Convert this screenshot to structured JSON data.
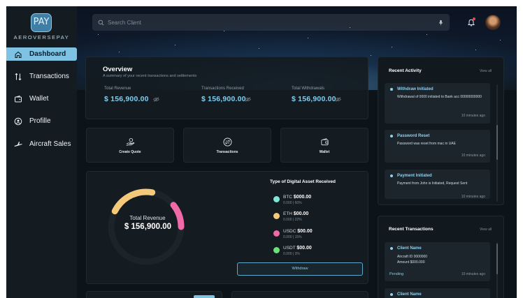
{
  "brand": {
    "logo_text": "PAY",
    "name": "AEROVERSEPAY"
  },
  "sidebar": {
    "items": [
      {
        "label": "Dashboard",
        "icon": "home-icon",
        "active": true
      },
      {
        "label": "Transactions",
        "icon": "arrows-updown-icon",
        "active": false
      },
      {
        "label": "Wallet",
        "icon": "wallet-icon",
        "active": false
      },
      {
        "label": "Profille",
        "icon": "user-circle-icon",
        "active": false
      },
      {
        "label": "Aircraft Sales",
        "icon": "airplane-icon",
        "active": false
      }
    ]
  },
  "header": {
    "search_placeholder": "Search Client",
    "icons": [
      "search-icon",
      "microphone-icon",
      "bell-icon",
      "avatar"
    ]
  },
  "overview": {
    "title": "Overview",
    "subtitle": "A summary of your recent transactions and settlements",
    "stats": [
      {
        "label": "Total Revenue",
        "value": "$ 156,900.00"
      },
      {
        "label": "Transactions Received",
        "value": "$ 156,900.00"
      },
      {
        "label": "Total Withdrawals",
        "value": "$ 156,900.00"
      }
    ]
  },
  "actions": [
    {
      "label": "Create Quote",
      "icon": "hand-coin-icon"
    },
    {
      "label": "Transactions",
      "icon": "exchange-icon"
    },
    {
      "label": "Wallet",
      "icon": "wallet-icon"
    }
  ],
  "revenue": {
    "label": "Total Revenue",
    "value": "$ 156,900.00",
    "assets_title": "Type of Digital Asset Received",
    "assets": [
      {
        "name": "BTC",
        "amount": "$000.00",
        "sub": "0.000 | 60%",
        "color": "#7ee6d8"
      },
      {
        "name": "ETH",
        "amount": "$00.00",
        "sub": "0.000 | 22%",
        "color": "#f5c97a"
      },
      {
        "name": "USDC",
        "amount": "$00.00",
        "sub": "0.000 | 15%",
        "color": "#f06aa8"
      },
      {
        "name": "USDT",
        "amount": "$00.00",
        "sub": "0.000 | 3%",
        "color": "#6ee07a"
      }
    ],
    "withdraw_label": "Withdraw"
  },
  "recent_activity": {
    "title": "Recent Activity",
    "view_all": "View all",
    "items": [
      {
        "title": "Withdraw Initiated",
        "body": "Withdrawal of  0000 initiated to Bank acc 00000000000",
        "time": "10 minutes ago"
      },
      {
        "title": "Password Reset",
        "body": "Password was reset from mac in UAE",
        "time": "10 minutes ago"
      },
      {
        "title": "Payment  Initiated",
        "body": "Payment from John is Initiated, Request Sent",
        "time": "10 minutes ago"
      }
    ]
  },
  "recent_transactions": {
    "title": "Recent Transactions",
    "view_all": "View all",
    "items": [
      {
        "name": "Client Name",
        "aircraft": "Aircraft ID 0000000",
        "amount": "Amount $000.000",
        "status": "Pending",
        "time": "10 minutes ago"
      },
      {
        "name": "Client Name"
      }
    ]
  },
  "colors": {
    "accent": "#7ec3e4",
    "value_blue": "#7ccff2",
    "background": "#0d1419",
    "panel": "#141b21"
  }
}
